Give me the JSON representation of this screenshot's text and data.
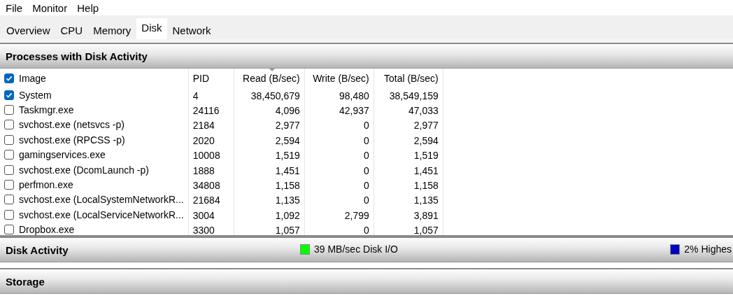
{
  "menu": [
    "File",
    "Monitor",
    "Help"
  ],
  "tabs": [
    {
      "label": "Overview",
      "selected": false
    },
    {
      "label": "CPU",
      "selected": false
    },
    {
      "label": "Memory",
      "selected": false
    },
    {
      "label": "Disk",
      "selected": true
    },
    {
      "label": "Network",
      "selected": false
    }
  ],
  "processes": {
    "title": "Processes with Disk Activity",
    "columns": [
      {
        "label": "Image",
        "checked": true
      },
      {
        "label": "PID"
      },
      {
        "label": "Read (B/sec)",
        "sorted": true
      },
      {
        "label": "Write (B/sec)"
      },
      {
        "label": "Total (B/sec)"
      }
    ],
    "rows": [
      {
        "checked": true,
        "image": "System",
        "pid": "4",
        "read": "38,450,679",
        "write": "98,480",
        "total": "38,549,159"
      },
      {
        "checked": false,
        "image": "Taskmgr.exe",
        "pid": "24116",
        "read": "4,096",
        "write": "42,937",
        "total": "47,033"
      },
      {
        "checked": false,
        "image": "svchost.exe (netsvcs -p)",
        "pid": "2184",
        "read": "2,977",
        "write": "0",
        "total": "2,977"
      },
      {
        "checked": false,
        "image": "svchost.exe (RPCSS -p)",
        "pid": "2020",
        "read": "2,594",
        "write": "0",
        "total": "2,594"
      },
      {
        "checked": false,
        "image": "gamingservices.exe",
        "pid": "10008",
        "read": "1,519",
        "write": "0",
        "total": "1,519"
      },
      {
        "checked": false,
        "image": "svchost.exe (DcomLaunch -p)",
        "pid": "1888",
        "read": "1,451",
        "write": "0",
        "total": "1,451"
      },
      {
        "checked": false,
        "image": "perfmon.exe",
        "pid": "34808",
        "read": "1,158",
        "write": "0",
        "total": "1,158"
      },
      {
        "checked": false,
        "image": "svchost.exe (LocalSystemNetworkR...",
        "pid": "21684",
        "read": "1,135",
        "write": "0",
        "total": "1,135"
      },
      {
        "checked": false,
        "image": "svchost.exe (LocalServiceNetworkR...",
        "pid": "3004",
        "read": "1,092",
        "write": "2,799",
        "total": "3,891"
      },
      {
        "checked": false,
        "image": "Dropbox.exe",
        "pid": "3300",
        "read": "1,057",
        "write": "0",
        "total": "1,057"
      }
    ]
  },
  "disk_activity": {
    "title": "Disk Activity",
    "legends": [
      {
        "label": "39 MB/sec Disk I/O",
        "color": "#00ff00"
      },
      {
        "label": "2% Highes",
        "color": "#0000c0"
      }
    ]
  },
  "storage": {
    "title": "Storage"
  }
}
